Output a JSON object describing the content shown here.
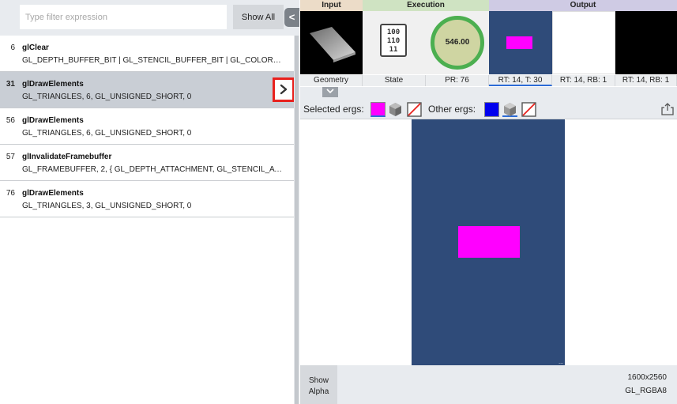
{
  "filter": {
    "placeholder": "Type filter expression",
    "value": "",
    "show_all_label": "Show All",
    "collapse_glyph": "<"
  },
  "calls": [
    {
      "index": "6",
      "name": "glClear",
      "args": "GL_DEPTH_BUFFER_BIT | GL_STENCIL_BUFFER_BIT | GL_COLOR_BUFFE...",
      "selected": false
    },
    {
      "index": "31",
      "name": "glDrawElements",
      "args": "GL_TRIANGLES, 6, GL_UNSIGNED_SHORT, 0",
      "selected": true
    },
    {
      "index": "56",
      "name": "glDrawElements",
      "args": "GL_TRIANGLES, 6, GL_UNSIGNED_SHORT, 0",
      "selected": false
    },
    {
      "index": "57",
      "name": "glInvalidateFramebuffer",
      "args": "GL_FRAMEBUFFER, 2, { GL_DEPTH_ATTACHMENT, GL_STENCIL_ATTAC...",
      "selected": false
    },
    {
      "index": "76",
      "name": "glDrawElements",
      "args": "GL_TRIANGLES, 3, GL_UNSIGNED_SHORT, 0",
      "selected": false
    }
  ],
  "groups": {
    "input": "Input",
    "execution": "Execution",
    "output": "Output"
  },
  "thumbnails": {
    "geometry_label": "Geometry",
    "state_label": "State",
    "state_digits": [
      "100",
      "110",
      "11"
    ],
    "pr_value": "546.00",
    "pr_label": "PR: 76",
    "rt1_label": "RT: 14, T: 30",
    "rt2_label": "RT: 14, RB: 1",
    "rt3_label": "RT: 14, RB: 1"
  },
  "toolbar": {
    "selected_label": "Selected ergs:",
    "other_label": "Other ergs:"
  },
  "framebuffer": {
    "size": "1600x2560",
    "format": "GL_RGBA8",
    "show_alpha_label": "Show\nAlpha"
  },
  "colors": {
    "framebuffer_bg": "#2f4b79",
    "draw_color": "#ff00ff",
    "other_erg_color": "#0000ee",
    "pr_ring": "#4caf50",
    "highlight": "#e8211d"
  }
}
